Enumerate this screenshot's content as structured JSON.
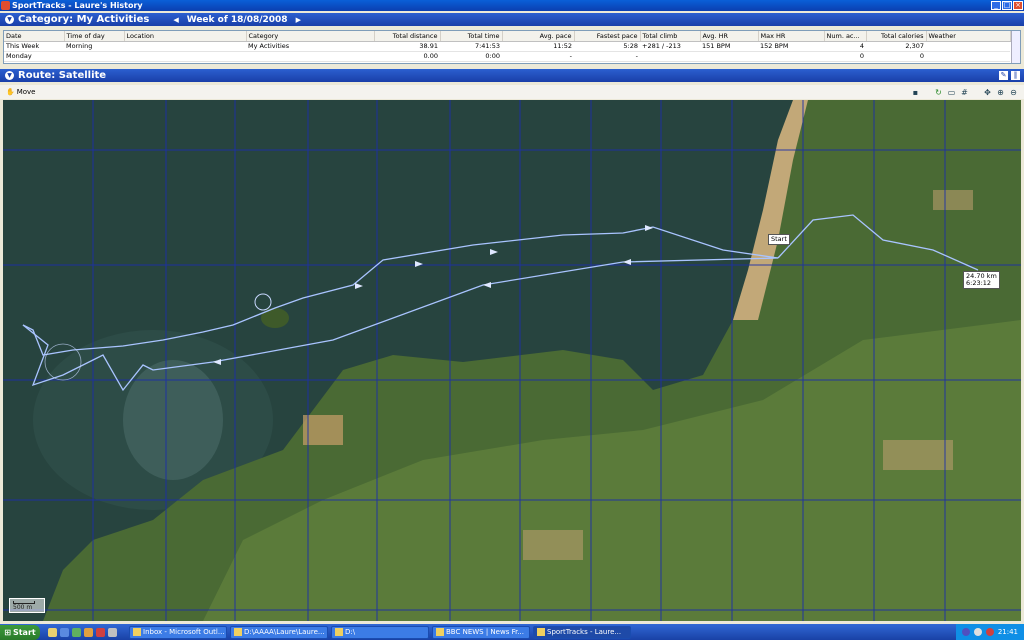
{
  "window": {
    "title": "SportTracks - Laure's History"
  },
  "category_panel": {
    "title": "Category: My Activities",
    "week_label": "Week of 18/08/2008",
    "prev_arrow": "◀",
    "next_arrow": "▶",
    "columns": [
      "Date",
      "Time of day",
      "Location",
      "Category",
      "Total distance",
      "Total time",
      "Avg. pace",
      "Fastest pace",
      "Total climb",
      "Avg. HR",
      "Max HR",
      "Num. ac...",
      "Total calories",
      "Weather"
    ],
    "rows": [
      [
        "This Week",
        "Morning",
        "",
        "My Activities",
        "38.91",
        "7:41:53",
        "11:52",
        "5:28",
        "+281 / -213",
        "151 BPM",
        "152 BPM",
        "4",
        "2,307",
        ""
      ],
      [
        "Monday",
        "",
        "",
        "",
        "0.00",
        "0:00",
        "-",
        "-",
        "",
        "",
        "",
        "0",
        "0",
        ""
      ]
    ]
  },
  "route_panel": {
    "title": "Route: Satellite",
    "move_label": "Move",
    "start_marker": "Start",
    "distance_marker_line1": "24.70 km",
    "distance_marker_line2": "6:23:12",
    "scale_label": "500 m"
  },
  "taskbar": {
    "start_label": "Start",
    "tasks": [
      "Inbox - Microsoft Outl...",
      "D:\\AAAA\\Laure\\Laure...",
      "D:\\",
      "BBC NEWS | News Fr...",
      "SportTracks - Laure..."
    ],
    "clock": "21:41"
  }
}
